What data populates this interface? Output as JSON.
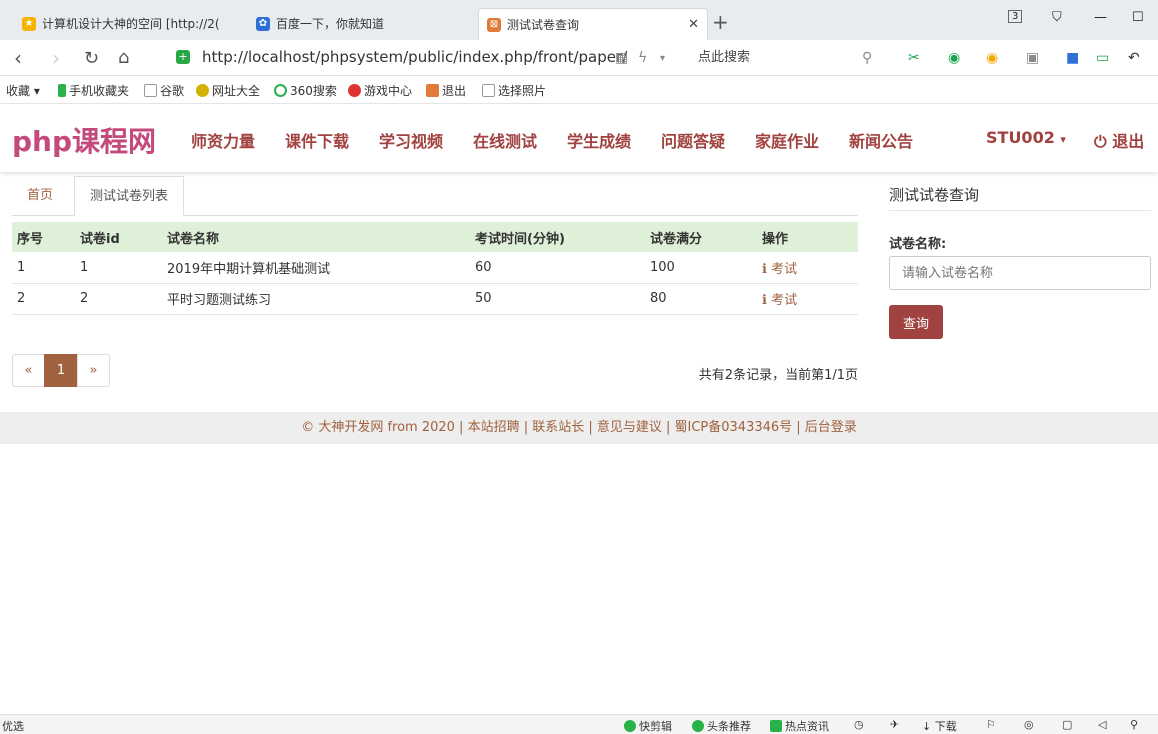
{
  "browser": {
    "tabs": [
      {
        "title": "计算机设计大神的空间 [http://2("
      },
      {
        "title": "百度一下，你就知道"
      },
      {
        "title": "测试试卷查询"
      }
    ],
    "tab_count": "3",
    "url": "http://localhost/phpsystem/public/index.php/front/paper/",
    "search_placeholder": "点此搜索",
    "bookmarks": [
      "收藏",
      "手机收藏夹",
      "谷歌",
      "网址大全",
      "360搜索",
      "游戏中心",
      "退出",
      "选择照片"
    ]
  },
  "site": {
    "logo": "php课程网",
    "menu": [
      "师资力量",
      "课件下载",
      "学习视频",
      "在线测试",
      "学生成绩",
      "问题答疑",
      "家庭作业",
      "新闻公告"
    ],
    "user": "STU002",
    "user_caret": "▾",
    "logout": "退出"
  },
  "page_tabs": {
    "home": "首页",
    "current": "测试试卷列表"
  },
  "table": {
    "headers": [
      "序号",
      "试卷id",
      "试卷名称",
      "考试时间(分钟)",
      "试卷满分",
      "操作"
    ],
    "rows": [
      {
        "no": "1",
        "id": "1",
        "name": "2019年中期计算机基础测试",
        "time": "60",
        "score": "100",
        "action": "考试"
      },
      {
        "no": "2",
        "id": "2",
        "name": "平时习题测试练习",
        "time": "50",
        "score": "80",
        "action": "考试"
      }
    ]
  },
  "pagination": {
    "prev": "«",
    "current": "1",
    "next": "»",
    "summary": "共有2条记录，当前第1/1页"
  },
  "sidebar": {
    "title": "测试试卷查询",
    "label": "试卷名称:",
    "placeholder": "请输入试卷名称",
    "button": "查询"
  },
  "footer": {
    "text": "© 大神开发网 from 2020 | 本站招聘 | 联系站长 | 意见与建议 | 蜀ICP备0343346号 | 后台登录"
  },
  "statusbar": {
    "left": "优选",
    "items": [
      "快剪辑",
      "头条推荐",
      "热点资讯",
      "下载"
    ]
  }
}
